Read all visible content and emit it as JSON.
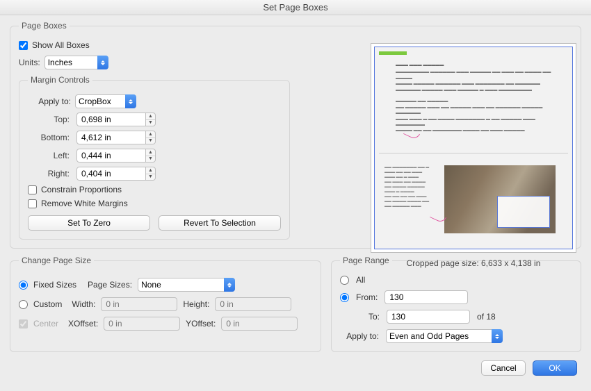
{
  "window": {
    "title": "Set Page Boxes"
  },
  "pageBoxes": {
    "legend": "Page Boxes",
    "showAllLabel": "Show All Boxes",
    "showAllChecked": true,
    "unitsLabel": "Units:",
    "unitsValue": "Inches",
    "marginControls": {
      "legend": "Margin Controls",
      "applyToLabel": "Apply to:",
      "applyToValue": "CropBox",
      "topLabel": "Top:",
      "topValue": "0,698 in",
      "bottomLabel": "Bottom:",
      "bottomValue": "4,612 in",
      "leftLabel": "Left:",
      "leftValue": "0,444 in",
      "rightLabel": "Right:",
      "rightValue": "0,404 in",
      "constrainLabel": "Constrain Proportions",
      "constrainChecked": false,
      "removeWhiteLabel": "Remove White Margins",
      "removeWhiteChecked": false,
      "setZeroLabel": "Set To Zero",
      "revertLabel": "Revert To Selection"
    },
    "previewCaption": "Cropped page size: 6,633 x 4,138 in"
  },
  "changeSize": {
    "legend": "Change Page Size",
    "fixedLabel": "Fixed Sizes",
    "pageSizesLabel": "Page Sizes:",
    "pageSizesValue": "None",
    "customLabel": "Custom",
    "widthLabel": "Width:",
    "widthPlaceholder": "0 in",
    "heightLabel": "Height:",
    "heightPlaceholder": "0 in",
    "centerLabel": "Center",
    "xoffLabel": "XOffset:",
    "xoffPlaceholder": "0 in",
    "yoffLabel": "YOffset:",
    "yoffPlaceholder": "0 in"
  },
  "pageRange": {
    "legend": "Page Range",
    "allLabel": "All",
    "fromLabel": "From:",
    "fromValue": "130",
    "toLabel": "To:",
    "toValue": "130",
    "ofLabel": "of 18",
    "applyLabel": "Apply to:",
    "applyValue": "Even and Odd Pages"
  },
  "buttons": {
    "cancel": "Cancel",
    "ok": "OK"
  }
}
